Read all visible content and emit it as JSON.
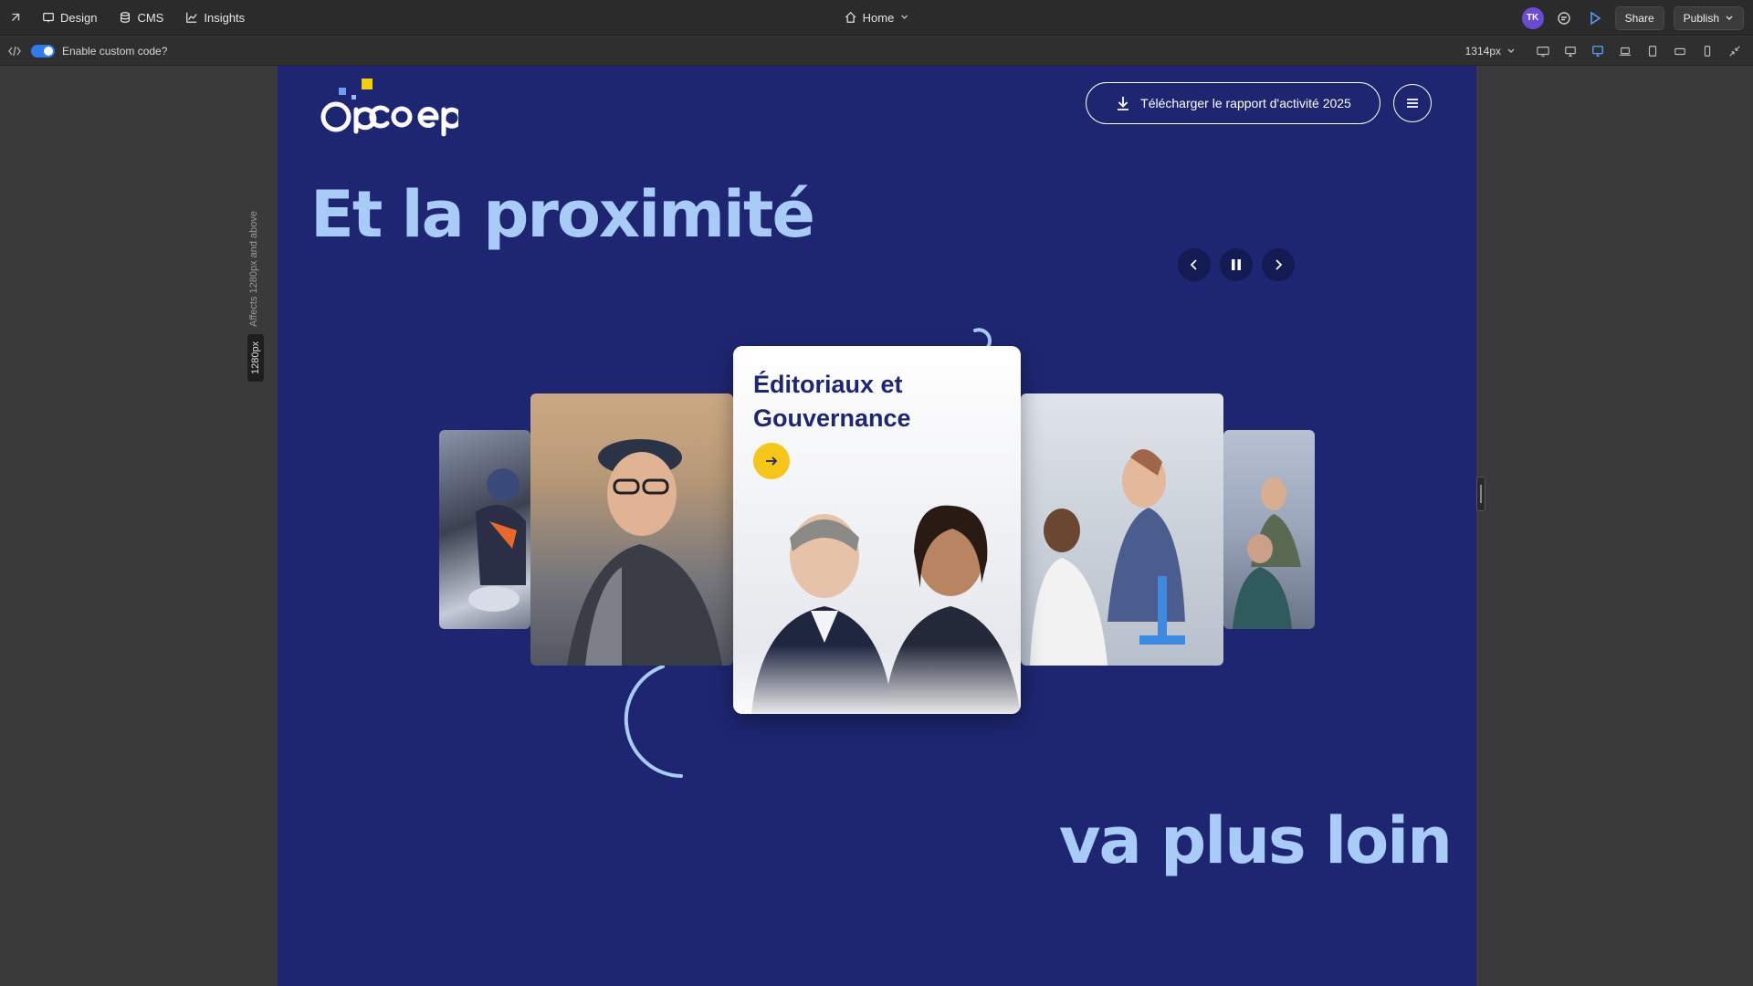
{
  "topbar": {
    "design_label": "Design",
    "cms_label": "CMS",
    "insights_label": "Insights",
    "page_selector": "Home",
    "avatar_initials": "TK",
    "share_label": "Share",
    "publish_label": "Publish"
  },
  "toolbar": {
    "custom_code_label": "Enable custom code?",
    "custom_code_enabled": true,
    "width_value": "1314px",
    "breakpoint_note": "Affects 1280px and above",
    "breakpoint_value": "1280px"
  },
  "site": {
    "download_label": "Télécharger le rapport d'activité 2025",
    "headline_top": "Et la proximité",
    "headline_bottom": "va plus loin",
    "card_title": "Éditoriaux et Gouvernance"
  },
  "colors": {
    "canvas_bg": "#1e2672",
    "headline": "#a9cbf7",
    "accent_yellow": "#f5c518",
    "toggle_blue": "#2d7bf0"
  }
}
